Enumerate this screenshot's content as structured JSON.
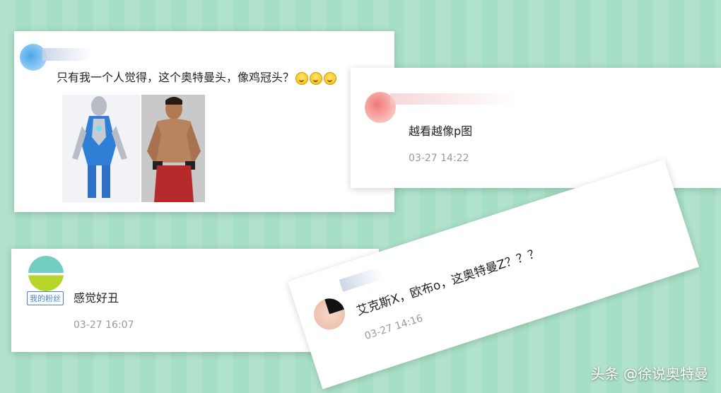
{
  "comment1": {
    "text": "只有我一个人觉得，这个奥特曼头，像鸡冠头？",
    "emoji_icons": [
      "smile-emoji-icon",
      "smile-emoji-icon",
      "smile-emoji-icon"
    ]
  },
  "comment2": {
    "text": "越看越像p图",
    "time": "03-27 14:22"
  },
  "comment3": {
    "badge": "我的粉丝",
    "text": "感觉好丑",
    "time": "03-27 16:07"
  },
  "comment4": {
    "text": "艾克斯X，欧布o，这奥特曼Z？？？",
    "time": "03-27 14:16"
  },
  "watermark": "头条 @徐说奥特曼",
  "colors": {
    "background": "#a7dfc6",
    "card": "#ffffff",
    "time": "#9a9a9a",
    "badge": "#4a7fd8"
  }
}
